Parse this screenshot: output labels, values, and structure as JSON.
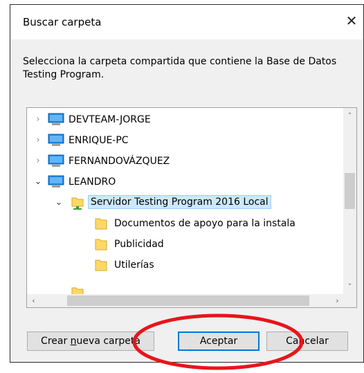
{
  "dialog": {
    "title": "Buscar carpeta",
    "close_symbol": "✕",
    "instruction": "Selecciona la carpeta compartida que contiene la Base de Datos Testing Program."
  },
  "tree": {
    "items": [
      {
        "label": "DEVTEAM-JORGE",
        "icon": "computer-icon",
        "expander": "›",
        "state": "collapsed"
      },
      {
        "label": "ENRIQUE-PC",
        "icon": "computer-icon",
        "expander": "›",
        "state": "collapsed"
      },
      {
        "label": "FERNANDOVÁZQUEZ",
        "icon": "computer-icon",
        "expander": "›",
        "state": "collapsed"
      },
      {
        "label": "LEANDRO",
        "icon": "computer-icon",
        "expander": "⌄",
        "state": "expanded"
      },
      {
        "label": "Servidor Testing Program 2016 Local",
        "icon": "shared-folder-icon",
        "expander": "⌄",
        "state": "expanded",
        "selected": true
      },
      {
        "label": "Documentos de apoyo para la instala",
        "icon": "folder-icon"
      },
      {
        "label": "Publicidad",
        "icon": "folder-icon"
      },
      {
        "label": "Utilerías",
        "icon": "folder-icon"
      }
    ],
    "scroll_up": "˄",
    "scroll_down": "˅",
    "scroll_left": "‹",
    "scroll_right": "›"
  },
  "buttons": {
    "new_folder_prefix": "Crear ",
    "new_folder_mnemonic": "n",
    "new_folder_suffix": "ueva carpeta",
    "ok": "Aceptar",
    "cancel": "Cancelar"
  },
  "colors": {
    "selection_bg": "#cce8ff",
    "selection_border": "#99d1ff",
    "default_button_border": "#0078d7",
    "annotation_ellipse": "#e8151b",
    "folder": "#ffd866",
    "monitor": "#1e88e5"
  }
}
